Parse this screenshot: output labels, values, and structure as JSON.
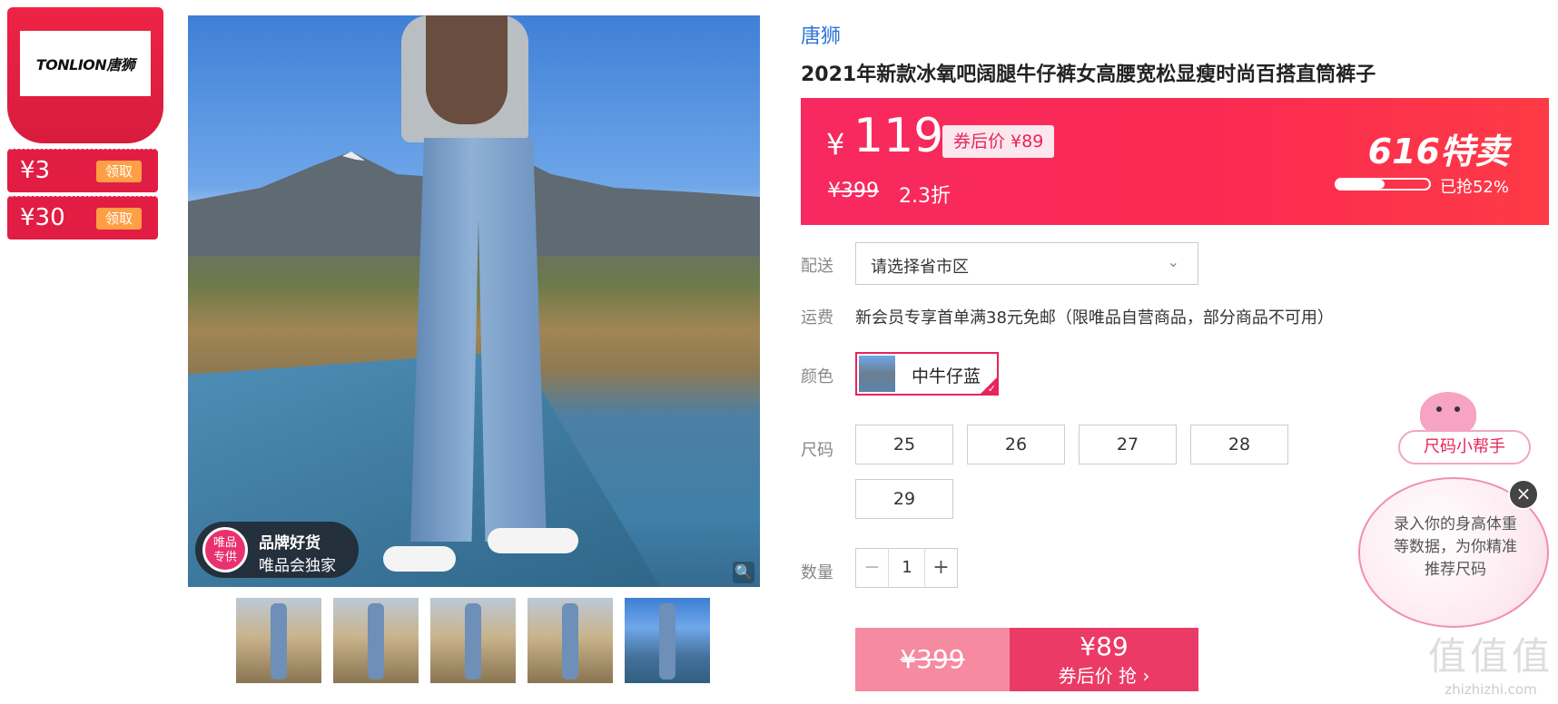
{
  "brand_card": {
    "logo_text": "TONLION唐狮"
  },
  "coupons": [
    {
      "amount": "¥3",
      "action": "领取"
    },
    {
      "amount": "¥30",
      "action": "领取"
    }
  ],
  "main_image": {
    "badge_circle": "唯品\n专供",
    "badge_title": "品牌好货",
    "badge_sub": "唯品会独家",
    "zoom_icon": "magnifier-icon"
  },
  "thumbnails": [
    "thumb-1",
    "thumb-2",
    "thumb-3",
    "thumb-4",
    "thumb-5"
  ],
  "product": {
    "brand": "唐狮",
    "title": "2021年新款冰氧吧阔腿牛仔裤女高腰宽松显瘦时尚百搭直筒裤子"
  },
  "price": {
    "currency": "¥",
    "current": "119",
    "after_coupon": "券后价 ¥89",
    "original": "¥399",
    "discount": "2.3折",
    "promo": "616特卖",
    "progress_percent": 52,
    "progress_text": "已抢52%"
  },
  "delivery": {
    "label": "配送",
    "placeholder": "请选择省市区"
  },
  "shipping": {
    "label": "运费",
    "text": "新会员专享首单满38元免邮（限唯品自营商品，部分商品不可用）"
  },
  "color": {
    "label": "颜色",
    "selected": "中牛仔蓝"
  },
  "size": {
    "label": "尺码",
    "options": [
      "25",
      "26",
      "27",
      "28",
      "29"
    ]
  },
  "quantity": {
    "label": "数量",
    "minus": "−",
    "value": "1",
    "plus": "+"
  },
  "buy": {
    "original": "¥399",
    "price": "¥89",
    "cta": "券后价 抢 ›"
  },
  "size_helper": {
    "title": "尺码小帮手",
    "text": "录入你的身高体重等数据，为你精准推荐尺码",
    "close": "×"
  },
  "watermark": {
    "big": "值值值",
    "small": "zhizhizhi.com"
  },
  "colors": {
    "accent": "#e8245a",
    "link": "#2b74d8",
    "coupon_bg": "#e21d44",
    "coupon_btn": "#ff9f45"
  }
}
